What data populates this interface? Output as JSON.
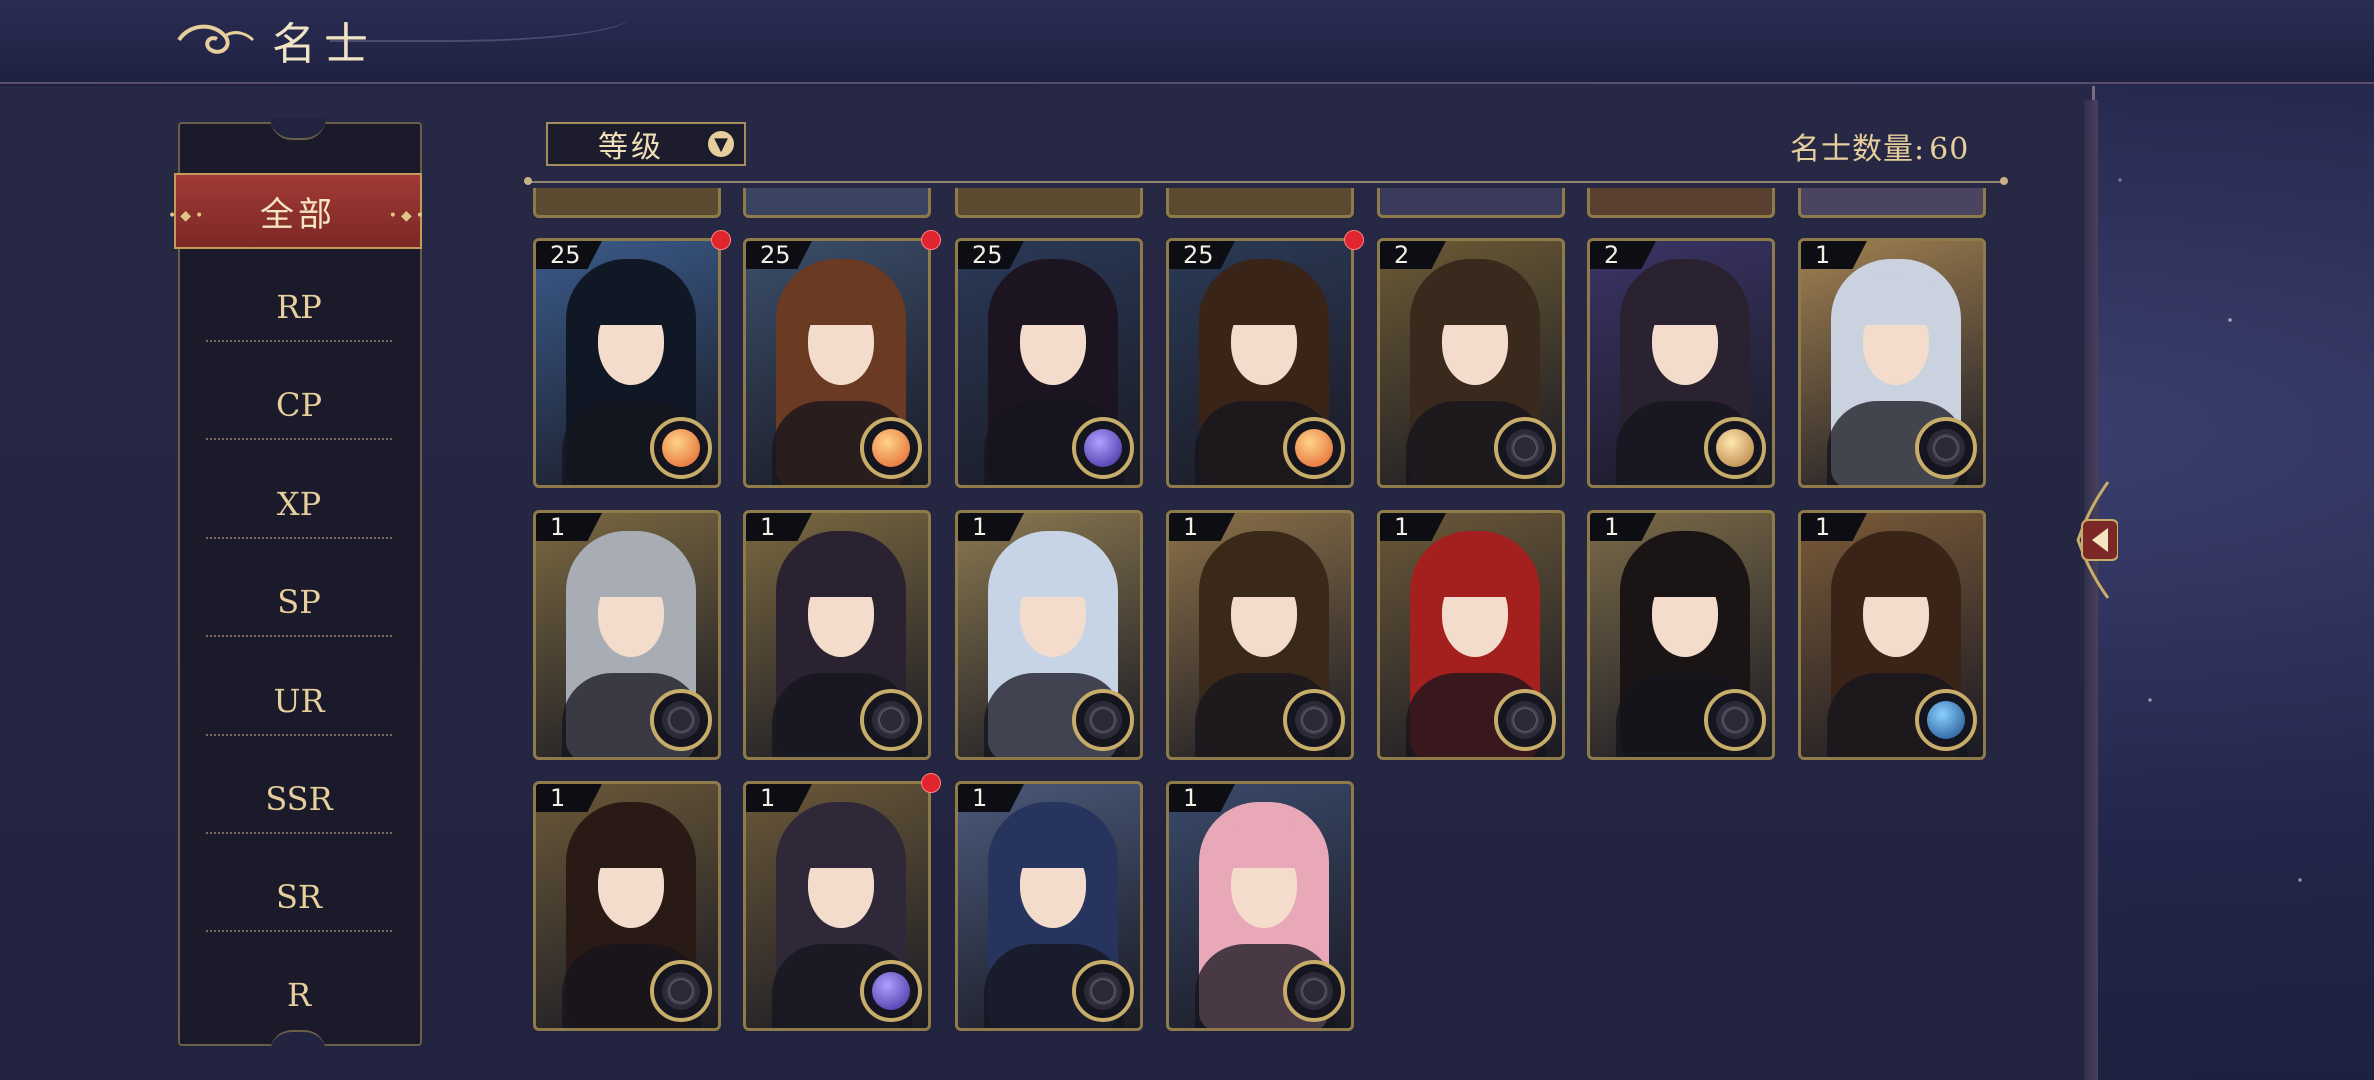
{
  "header": {
    "title": "名士"
  },
  "sidebar": {
    "active": "全部",
    "items": [
      "RP",
      "CP",
      "XP",
      "SP",
      "UR",
      "SSR",
      "SR",
      "R"
    ]
  },
  "toolbar": {
    "sort_label": "等级",
    "count_label": "名士数量:",
    "count_value": "60"
  },
  "cards": [
    {
      "level": "25",
      "hair": "#101826",
      "bg": "#3a5b8a",
      "element": "orange-orb-icon",
      "dot": true
    },
    {
      "level": "25",
      "hair": "#6b3a22",
      "bg": "#3b4e6a",
      "element": "orange-orb-icon",
      "dot": true
    },
    {
      "level": "25",
      "hair": "#1c1420",
      "bg": "#2a3a58",
      "element": "purple-orb-icon",
      "dot": false
    },
    {
      "level": "25",
      "hair": "#3a2418",
      "bg": "#2b3a56",
      "element": "orange-orb-icon",
      "dot": true
    },
    {
      "level": "2",
      "hair": "#3a2a1e",
      "bg": "#6b5a34",
      "element": "compass-icon",
      "dot": false
    },
    {
      "level": "2",
      "hair": "#2a2230",
      "bg": "#3a3466",
      "element": "moon-orb-icon",
      "dot": false
    },
    {
      "level": "1",
      "hair": "#c9d2de",
      "bg": "#a08050",
      "element": "compass-icon",
      "dot": false
    },
    {
      "level": "1",
      "hair": "#a8acb4",
      "bg": "#7a6840",
      "element": "compass-icon",
      "dot": false
    },
    {
      "level": "1",
      "hair": "#2a2230",
      "bg": "#7a6840",
      "element": "compass-icon",
      "dot": false
    },
    {
      "level": "1",
      "hair": "#c6d4e6",
      "bg": "#8a7850",
      "element": "compass-icon",
      "dot": false
    },
    {
      "level": "1",
      "hair": "#3a2818",
      "bg": "#8a7048",
      "element": "compass-icon",
      "dot": false
    },
    {
      "level": "1",
      "hair": "#a4201e",
      "bg": "#6a5838",
      "element": "compass-icon",
      "dot": false
    },
    {
      "level": "1",
      "hair": "#1a1414",
      "bg": "#7a6a48",
      "element": "compass-icon",
      "dot": false
    },
    {
      "level": "1",
      "hair": "#3a2418",
      "bg": "#7a5a38",
      "element": "blue-orb-icon",
      "dot": false
    },
    {
      "level": "1",
      "hair": "#2a1a16",
      "bg": "#6a5838",
      "element": "compass-icon",
      "dot": false
    },
    {
      "level": "1",
      "hair": "#2e2838",
      "bg": "#6a5838",
      "element": "purple-orb-icon",
      "dot": true
    },
    {
      "level": "1",
      "hair": "#27345e",
      "bg": "#4a5a7a",
      "element": "compass-icon",
      "dot": false
    },
    {
      "level": "1",
      "hair": "#e8a8b8",
      "bg": "#3a4a6a",
      "element": "compass-icon",
      "dot": false
    }
  ],
  "colors": {
    "accent_red": "#a03a36",
    "gold": "#c7ad69",
    "notify_dot": "#e0252e"
  }
}
